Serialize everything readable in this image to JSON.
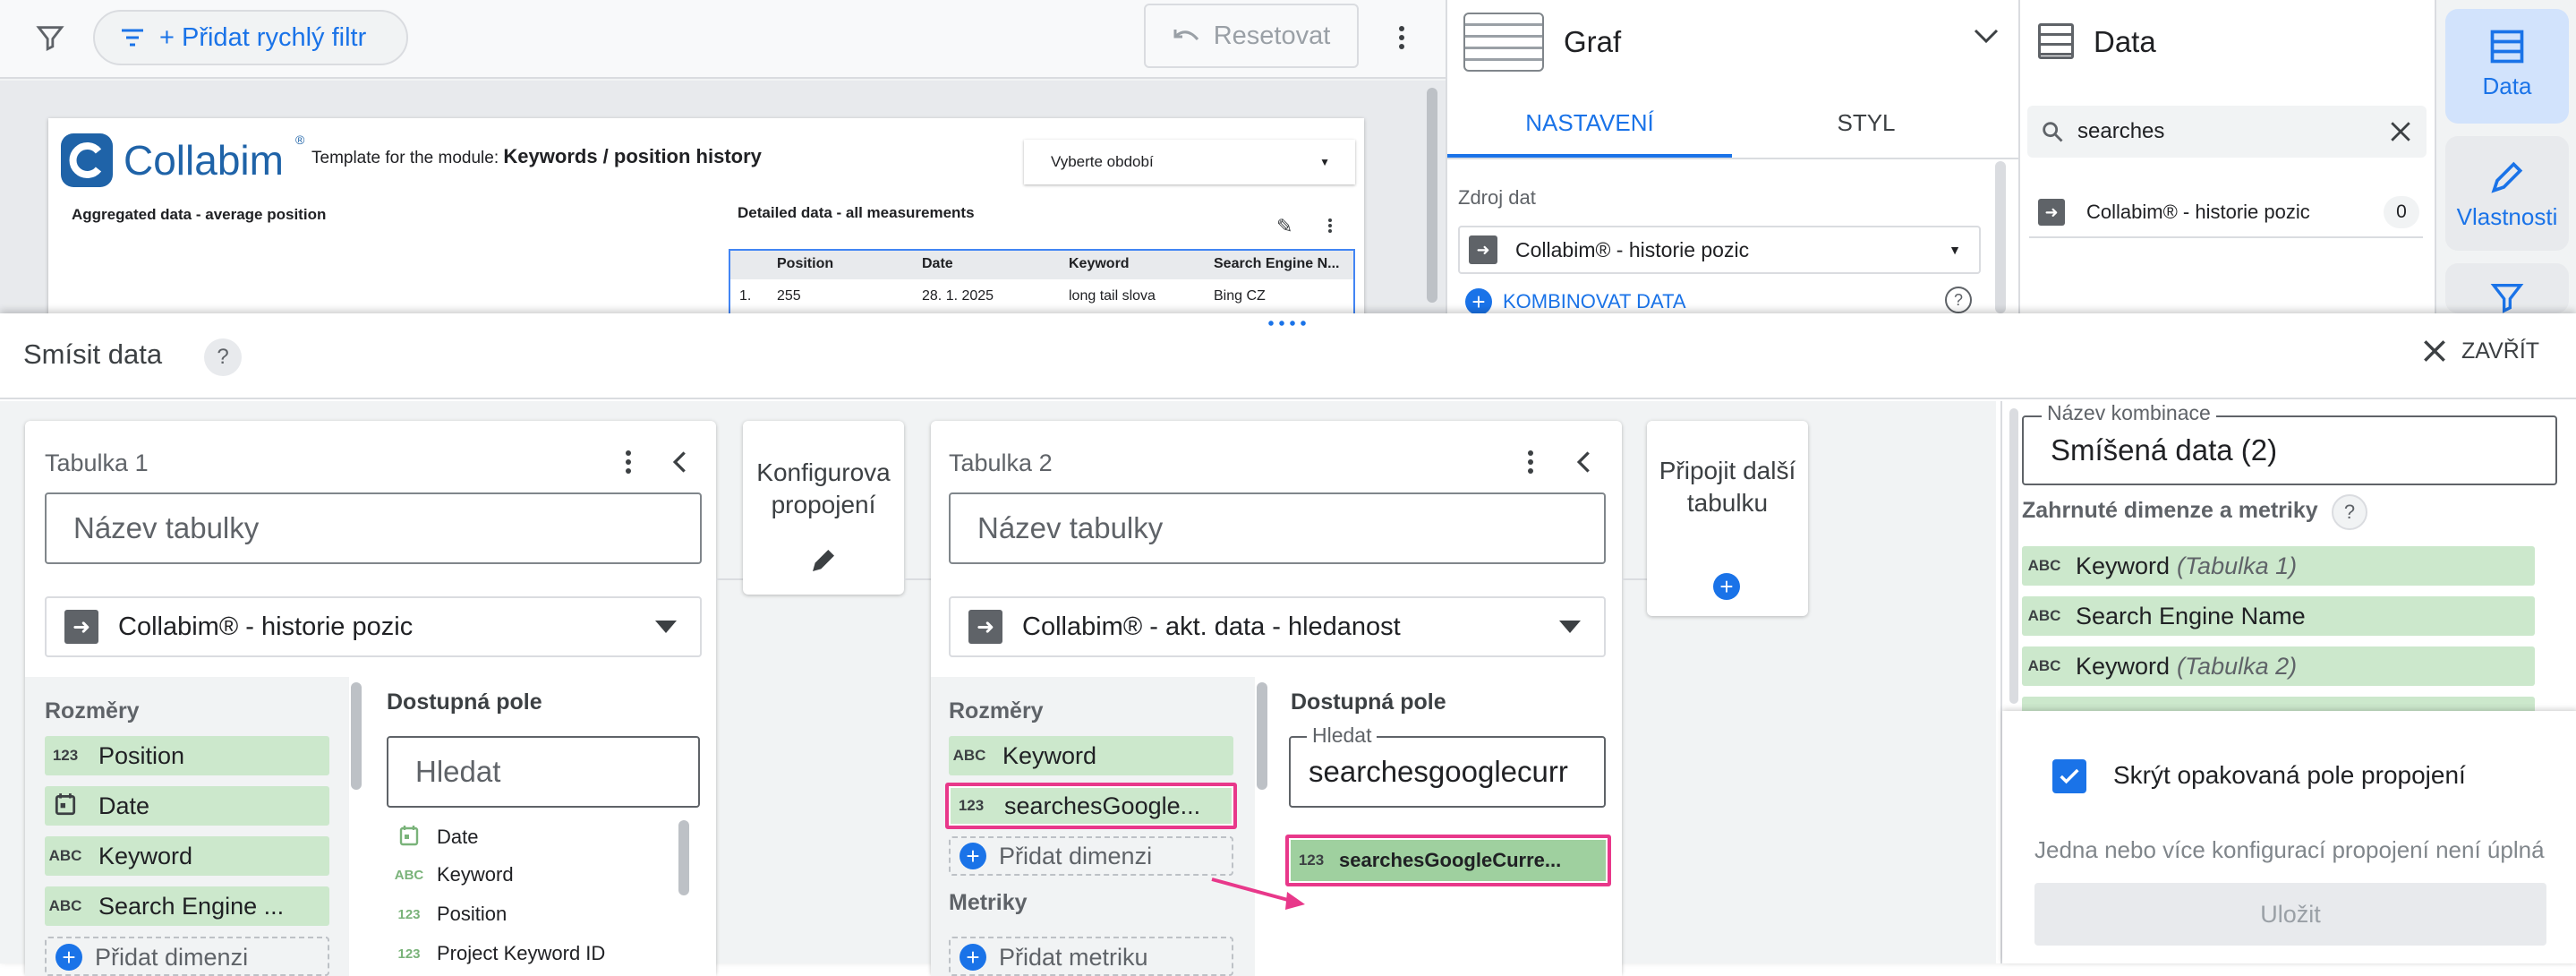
{
  "toolbar": {
    "add_filter_label": "+ Přidat rychlý filtr",
    "reset_label": "Resetovat"
  },
  "report": {
    "logo_text": "Collabim",
    "template_prefix": "Template for the module:",
    "template_module": "Keywords / position history",
    "period_select": "Vyberte období",
    "aggregated_title": "Aggregated data - average position",
    "detailed_title": "Detailed data - all measurements",
    "table_headers": [
      "Position",
      "Date",
      "Keyword",
      "Search Engine N..."
    ],
    "table_row": [
      "1.",
      "255",
      "28. 1. 2025",
      "long tail slova",
      "Bing CZ"
    ]
  },
  "chart_panel": {
    "title": "Graf",
    "tabs": [
      "NASTAVENÍ",
      "STYL"
    ],
    "source_label": "Zdroj dat",
    "source_value": "Collabim® - historie pozic",
    "blend_link": "KOMBINOVAT DATA"
  },
  "data_panel": {
    "title": "Data",
    "search_value": "searches",
    "result_name": "Collabim® - historie pozic",
    "result_count": "0"
  },
  "rail": {
    "data_label": "Data",
    "props_label": "Vlastnosti"
  },
  "blend": {
    "title": "Smísit data",
    "close_label": "ZAVŘÍT",
    "table1": {
      "label": "Tabulka 1",
      "name_placeholder": "Název tabulky",
      "source": "Collabim® - historie pozic",
      "dims_label": "Rozměry",
      "dims": [
        {
          "type": "123",
          "name": "Position"
        },
        {
          "type": "date",
          "name": "Date"
        },
        {
          "type": "ABC",
          "name": "Keyword"
        },
        {
          "type": "ABC",
          "name": "Search Engine ..."
        }
      ],
      "add_dim": "Přidat dimenzi",
      "avail_label": "Dostupná pole",
      "search_placeholder": "Hledat",
      "fields": [
        {
          "type": "date",
          "name": "Date"
        },
        {
          "type": "ABC",
          "name": "Keyword"
        },
        {
          "type": "123",
          "name": "Position"
        },
        {
          "type": "123",
          "name": "Project Keyword ID"
        }
      ]
    },
    "join1": {
      "label": "Konfigurova propojení"
    },
    "table2": {
      "label": "Tabulka 2",
      "name_placeholder": "Název tabulky",
      "source": "Collabim® - akt. data - hledanost",
      "dims_label": "Rozměry",
      "dims": [
        {
          "type": "ABC",
          "name": "Keyword"
        },
        {
          "type": "123",
          "name": "searchesGoogle..."
        }
      ],
      "add_dim": "Přidat dimenzi",
      "metrics_label": "Metriky",
      "add_metric": "Přidat metriku",
      "avail_label": "Dostupná pole",
      "search_label": "Hledat",
      "search_value": "searchesgooglecurr",
      "field_dragged": {
        "type": "123",
        "name": "searchesGoogleCurre..."
      }
    },
    "join2": {
      "label": "Připojit další tabulku"
    },
    "right": {
      "combo_name_label": "Název kombinace",
      "combo_name_value": "Smíšená data (2)",
      "included_label": "Zahrnuté dimenze a metriky",
      "included": [
        {
          "type": "ABC",
          "name": "Keyword",
          "suffix": "(Tabulka 1)"
        },
        {
          "type": "ABC",
          "name": "Search Engine Name",
          "suffix": ""
        },
        {
          "type": "ABC",
          "name": "Keyword",
          "suffix": "(Tabulka 2)"
        }
      ],
      "hide_repeated_label": "Skrýt opakovaná pole propojení",
      "warning": "Jedna nebo více konfigurací propojení není úplná",
      "save_label": "Uložit"
    }
  },
  "colors": {
    "accent": "#1a73e8",
    "chip_green": "#cce8cc",
    "highlight_pink": "#e8388a"
  }
}
